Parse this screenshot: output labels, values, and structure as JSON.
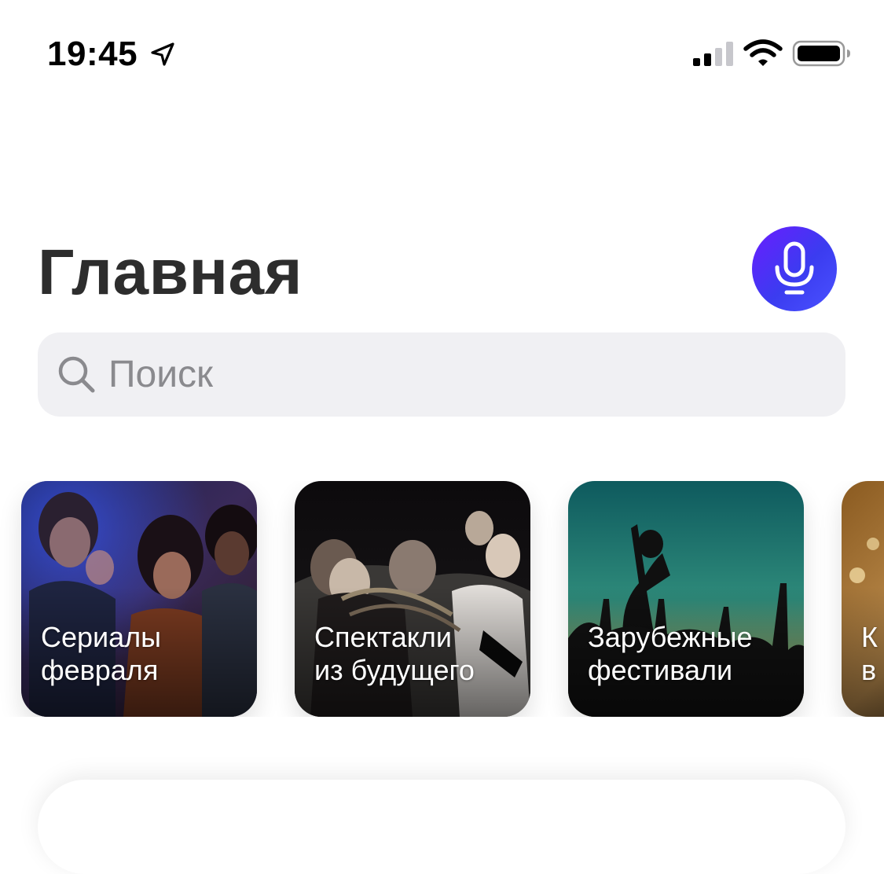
{
  "status_bar": {
    "time": "19:45",
    "icons": [
      "location-arrow-icon",
      "cellular-signal-icon",
      "wifi-icon",
      "battery-icon"
    ]
  },
  "header": {
    "title": "Главная",
    "mic_icon": "microphone-icon",
    "mic_gradient": [
      "#6a1dff",
      "#3b3cf0"
    ]
  },
  "search": {
    "placeholder": "Поиск",
    "value": "",
    "icon": "search-icon"
  },
  "cards": [
    {
      "line1": "Сериалы",
      "line2": "февраля"
    },
    {
      "line1": "Спектакли",
      "line2": "из будущего"
    },
    {
      "line1": "Зарубежные",
      "line2": "фестивали"
    },
    {
      "line1": "К",
      "line2": "в"
    }
  ],
  "colors": {
    "accent": "#4a3cf5",
    "search_bg": "#f0f0f3",
    "title": "#2d2d2d"
  }
}
